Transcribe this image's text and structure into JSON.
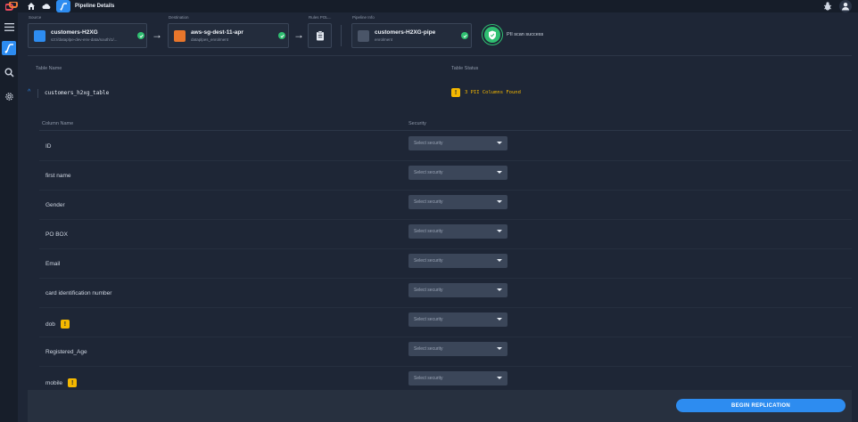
{
  "topbar": {
    "tab_label": "Pipeline Details"
  },
  "sidebar": {
    "items": [
      {
        "icon": "hamburger-menu-icon"
      },
      {
        "icon": "pipeline-icon",
        "active": true
      },
      {
        "icon": "search-icon"
      },
      {
        "icon": "gear-icon"
      }
    ]
  },
  "pipeline": {
    "source": {
      "label": "Source",
      "title": "customers-H2XG",
      "subtitle": "s3://dataplpe-dev-env-data/south/1/..."
    },
    "destination": {
      "label": "Destination",
      "title": "aws-sg-dest-11-apr",
      "subtitle": "dataplpes_enrolment"
    },
    "rules": {
      "label": "Rules POL..."
    },
    "pipeline_info": {
      "label": "Pipeline Info",
      "title": "customers-H2XG-pipe",
      "subtitle": "enrolment"
    },
    "pii_status": "PII scan success"
  },
  "table_header": {
    "name_label": "Table Name",
    "status_label": "Table Status"
  },
  "table": {
    "name": "customers_h2xg_table",
    "status": "3 PII Columns Found"
  },
  "columns_header": {
    "name_label": "Column Name",
    "security_label": "Security"
  },
  "columns": [
    {
      "name": "ID",
      "pii": false,
      "security": "Select security"
    },
    {
      "name": "first name",
      "pii": false,
      "security": "Select security"
    },
    {
      "name": "Gender",
      "pii": false,
      "security": "Select security"
    },
    {
      "name": "PO BOX",
      "pii": false,
      "security": "Select security"
    },
    {
      "name": "Email",
      "pii": false,
      "security": "Select security"
    },
    {
      "name": "card identification number",
      "pii": false,
      "security": "Select security"
    },
    {
      "name": "dob",
      "pii": true,
      "security": "Select security"
    },
    {
      "name": "Registered_Age",
      "pii": false,
      "security": "Select security"
    },
    {
      "name": "mobile",
      "pii": true,
      "security": "Select security"
    }
  ],
  "footer": {
    "begin_label": "BEGIN REPLICATION"
  },
  "colors": {
    "accent": "#2d8cf0",
    "success": "#2fbf71",
    "warning": "#f5b800",
    "background": "#1e2636"
  }
}
